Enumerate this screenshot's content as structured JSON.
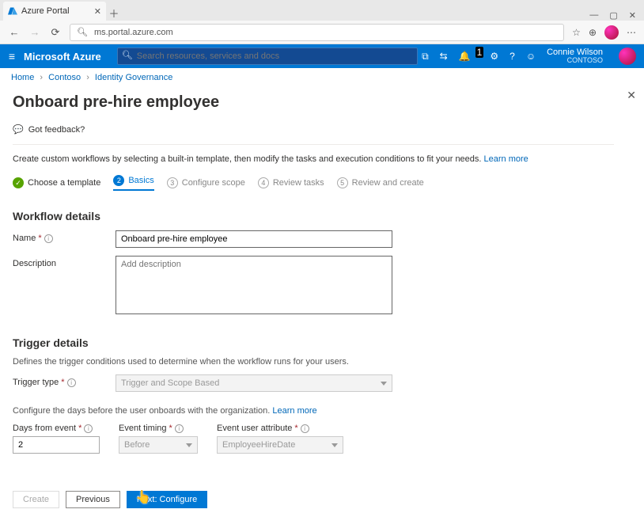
{
  "browser": {
    "tab_title": "Azure Portal",
    "url": "ms.portal.azure.com"
  },
  "topbar": {
    "brand": "Microsoft Azure",
    "search_placeholder": "Search resources, services and docs",
    "notification_count": "1",
    "user_name": "Connie Wilson",
    "user_org": "CONTOSO"
  },
  "crumbs": {
    "home": "Home",
    "level2": "Contoso",
    "level3": "Identity Governance"
  },
  "page": {
    "title": "Onboard pre-hire employee",
    "feedback": "Got feedback?",
    "intro": "Create custom workflows by selecting a built-in template, then modify the tasks and execution conditions to fit your needs. ",
    "learn_more": "Learn more"
  },
  "wizard": {
    "s1": "Choose a template",
    "s2": "Basics",
    "s3": "Configure scope",
    "s4": "Review tasks",
    "s5": "Review and create"
  },
  "form": {
    "section1": "Workflow details",
    "name_label": "Name",
    "name_value": "Onboard pre-hire employee",
    "desc_label": "Description",
    "desc_placeholder": "Add description",
    "section2": "Trigger details",
    "trigger_sub": "Defines the trigger conditions used to determine when the workflow runs for your users.",
    "trigger_type_label": "Trigger type",
    "trigger_type_value": "Trigger and Scope Based",
    "config_days": "Configure the days before the user onboards with the organization. ",
    "days_label": "Days from event",
    "days_value": "2",
    "timing_label": "Event timing",
    "timing_value": "Before",
    "attr_label": "Event user attribute",
    "attr_value": "EmployeeHireDate"
  },
  "footer": {
    "create": "Create",
    "prev": "Previous",
    "next": "Next: Configure"
  }
}
